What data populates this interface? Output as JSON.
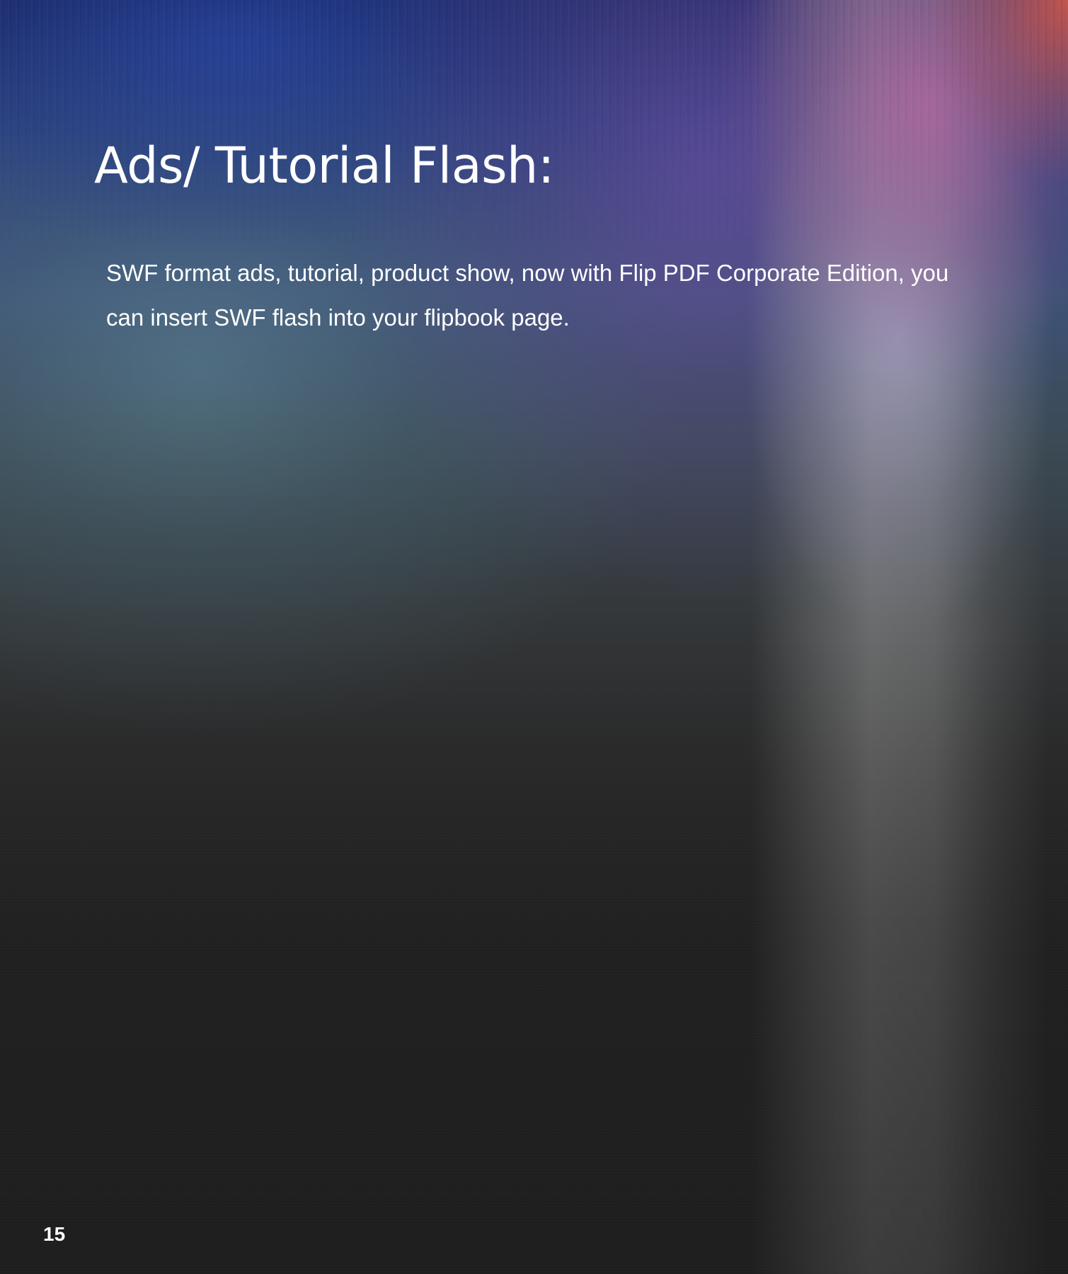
{
  "page": {
    "title": "Ads/ Tutorial Flash:",
    "body": "SWF format ads, tutorial, product show, now with Flip PDF Corporate Edition, you can insert SWF flash into your flipbook page.",
    "page_number": "15"
  },
  "colors": {
    "text": "#ffffff",
    "background_dark": "#1f1f1f",
    "accent_blue": "#1c2b63",
    "accent_purple": "#7850aa",
    "accent_pink": "#be64a0",
    "accent_red": "#dc5a46"
  }
}
